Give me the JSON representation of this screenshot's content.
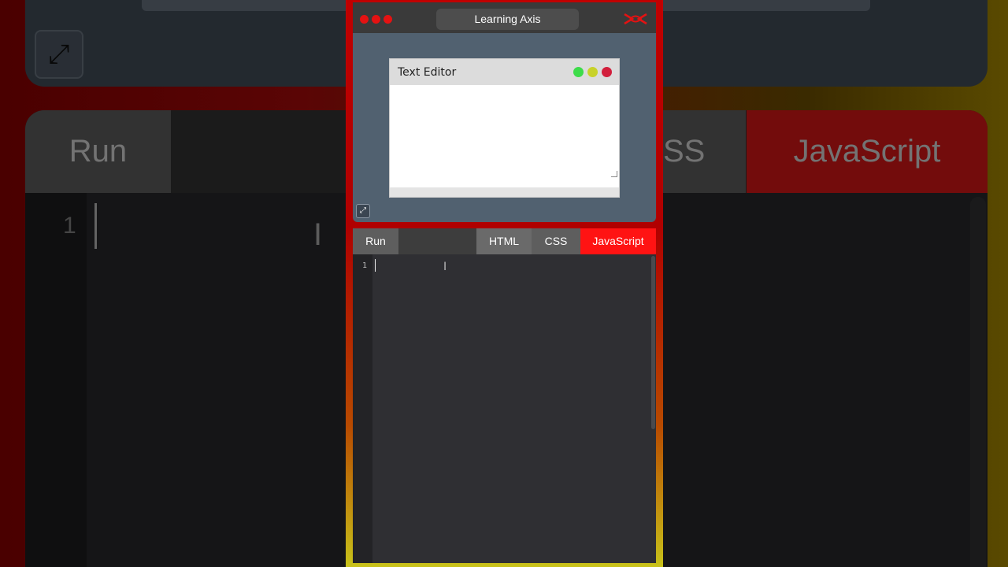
{
  "app": {
    "title": "Learning Axis",
    "colors": {
      "accent": "#ff1313",
      "window_dot": "#e51212",
      "brand_icon": "#e51212"
    }
  },
  "preview": {
    "window_title": "Text Editor",
    "window_buttons": [
      "green-dot",
      "yellow-dot",
      "red-dot"
    ],
    "expand_icon": "expand-arrows-icon"
  },
  "toolbar": {
    "run_label": "Run",
    "tabs": [
      {
        "label": "HTML",
        "active": false
      },
      {
        "label": "CSS",
        "active": false
      },
      {
        "label": "JavaScript",
        "active": true
      }
    ]
  },
  "editor": {
    "line_numbers": [
      "1"
    ],
    "content": ""
  }
}
